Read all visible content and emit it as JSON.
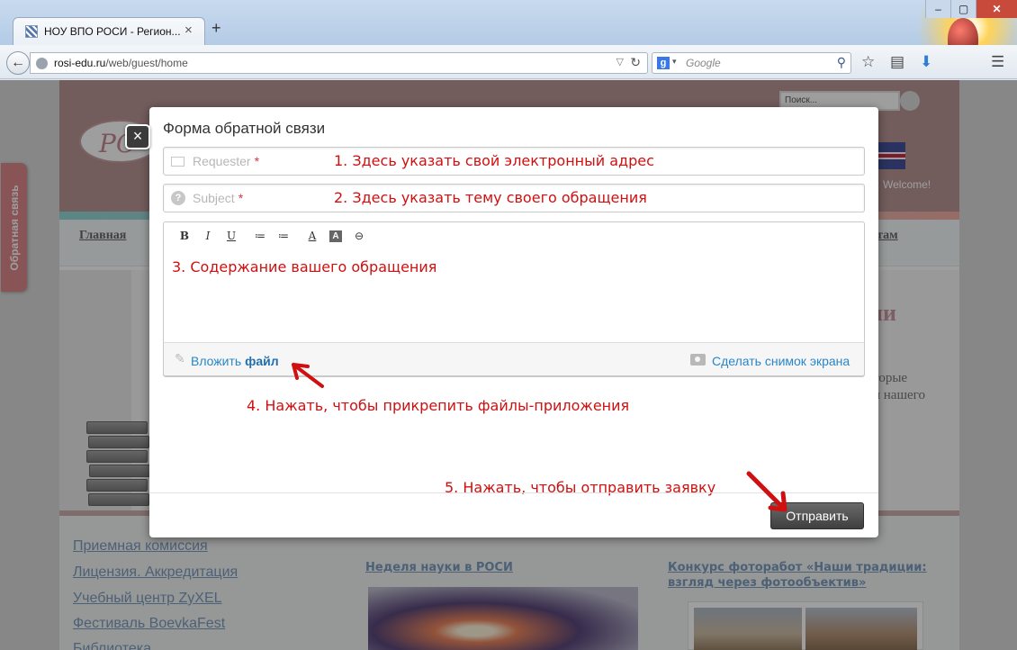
{
  "browser": {
    "tab_title": "НОУ ВПО РОСИ - Регион...",
    "tab_close": "×",
    "new_tab": "+",
    "url_host": "rosi-edu.ru",
    "url_path": "/web/guest/home",
    "search_engine_letter": "g",
    "search_placeholder": "Google",
    "window_buttons": [
      "‒",
      "▢",
      "✕"
    ]
  },
  "site": {
    "search_placeholder": "Поиск...",
    "welcome": "Welcome!",
    "nav_main": "Главная",
    "nav_right": "нтам",
    "heading_fragment": "ии",
    "text_fragment_1": "торые",
    "text_fragment_2": "и нашего",
    "left_links": [
      "Приемная комиссия",
      "Лицензия. Аккредитация",
      "Учебный центр ZyXEL",
      "Фестиваль BoevkaFest",
      "Библиотека"
    ],
    "news": [
      {
        "title": "Неделя науки в РОСИ"
      },
      {
        "title": "Конкурс фоторабот «Наши традиции: взгляд через фотообъектив»"
      }
    ],
    "feedback_tab": "Обратная связь"
  },
  "modal": {
    "close": "×",
    "title": "Форма обратной связи",
    "requester_placeholder": "Requester",
    "subject_placeholder": "Subject",
    "required_mark": "*",
    "toolbar": [
      "B",
      "I",
      "U",
      "≔",
      "≔",
      "A",
      "A",
      "⊖"
    ],
    "attach_prefix": "Вложить",
    "attach_bold": "файл",
    "screenshot_link": "Сделать снимок экрана",
    "submit": "Отправить"
  },
  "annotations": {
    "note1": "1. Здесь указать свой электронный адрес",
    "note2": "2. Здесь указать тему своего обращения",
    "note3": "3. Содержание вашего обращения",
    "note4": "4. Нажать, чтобы прикрепить файлы-приложения",
    "note5": "5. Нажать, чтобы отправить заявку",
    "color": "#d01010"
  }
}
